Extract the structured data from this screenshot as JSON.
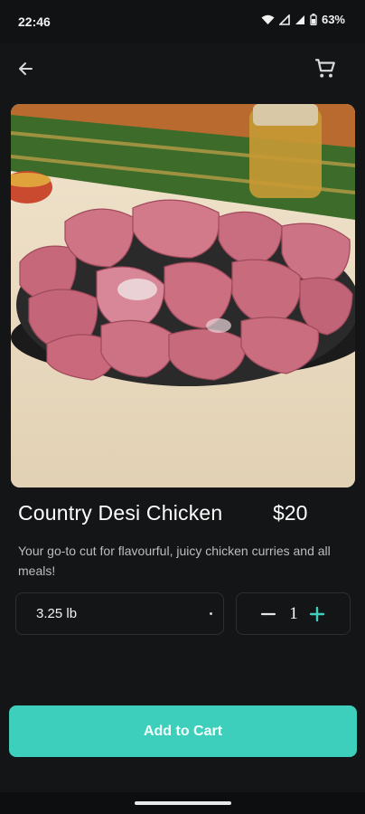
{
  "status": {
    "time": "22:46",
    "battery": "63%"
  },
  "appbar": {
    "back_icon": "arrow-left-icon",
    "cart_icon": "shopping-cart-icon"
  },
  "product": {
    "image_icon": "product-photo",
    "title": "Country Desi Chicken",
    "price": "$20",
    "description": "Your go-to cut for flavourful, juicy chicken curries and all meals!"
  },
  "options": {
    "weight_selected": "3.25 lb",
    "quantity": "1"
  },
  "actions": {
    "add_to_cart": "Add to Cart"
  },
  "colors": {
    "accent": "#3ecfbc",
    "background": "#141516"
  }
}
